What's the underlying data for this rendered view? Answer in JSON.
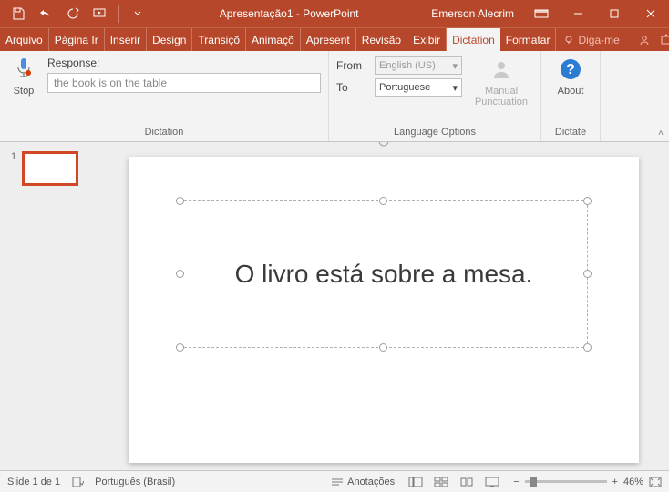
{
  "titlebar": {
    "title": "Apresentação1 - PowerPoint",
    "user": "Emerson Alecrim"
  },
  "tabs": {
    "items": [
      "Arquivo",
      "Página Ir",
      "Inserir",
      "Design",
      "Transiçõ",
      "Animaçõ",
      "Apresent",
      "Revisão",
      "Exibir",
      "Dictation",
      "Formatar"
    ],
    "active_index": 9,
    "tellme": "Diga-me"
  },
  "ribbon": {
    "stop": "Stop",
    "response_label": "Response:",
    "response_value": "the book is on the table",
    "dictation_group": "Dictation",
    "from": "From",
    "to": "To",
    "from_lang": "English (US)",
    "to_lang": "Portuguese",
    "lang_group": "Language Options",
    "manual": "Manual Punctuation",
    "about": "About",
    "dictate_group": "Dictate"
  },
  "thumbnails": {
    "slide1_num": "1"
  },
  "slide": {
    "text": "O livro está sobre a mesa."
  },
  "status": {
    "slide_indicator": "Slide 1 de 1",
    "language": "Português (Brasil)",
    "notes": "Anotações",
    "zoom": "46%"
  }
}
